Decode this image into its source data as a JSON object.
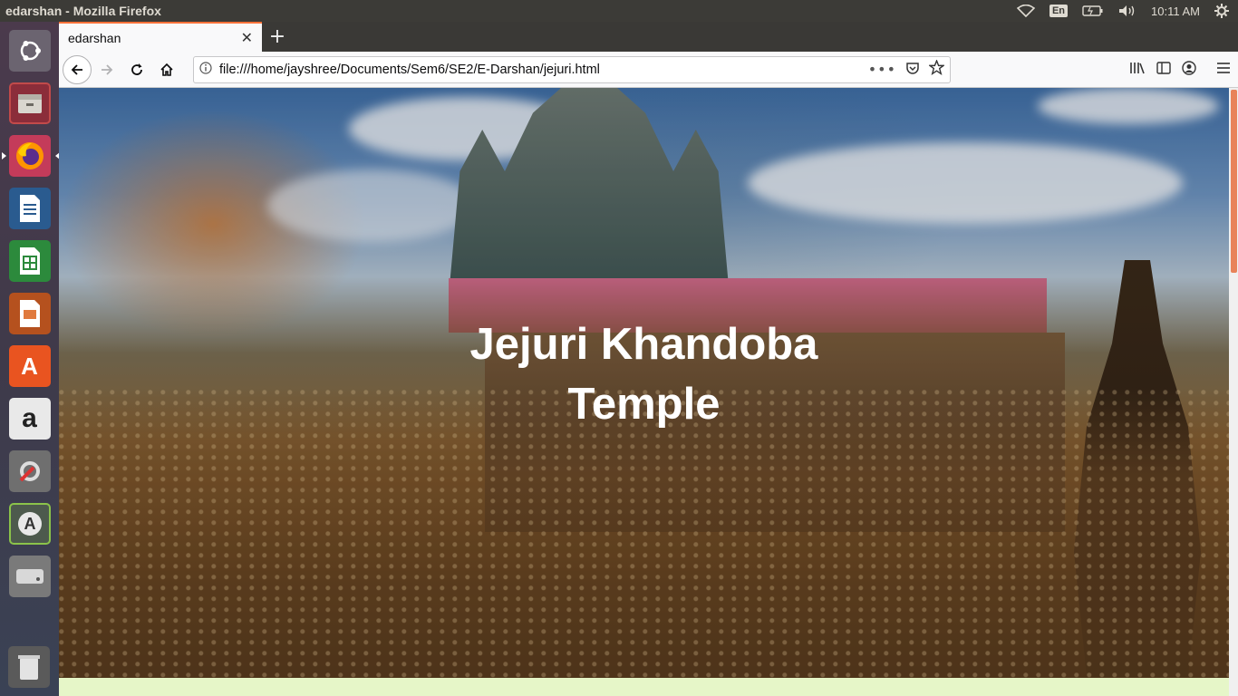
{
  "os_panel": {
    "window_title": "edarshan - Mozilla Firefox",
    "keyboard_layout": "En",
    "clock": "10:11 AM",
    "icons": [
      "wifi-icon",
      "keyboard-layout-indicator",
      "battery-icon",
      "volume-icon",
      "settings-gear-icon"
    ]
  },
  "launcher": {
    "items": [
      {
        "name": "ubuntu-dash-icon"
      },
      {
        "name": "files-icon"
      },
      {
        "name": "firefox-icon"
      },
      {
        "name": "libreoffice-writer-icon"
      },
      {
        "name": "libreoffice-calc-icon"
      },
      {
        "name": "libreoffice-impress-icon"
      },
      {
        "name": "ubuntu-software-icon"
      },
      {
        "name": "amazon-icon"
      },
      {
        "name": "system-settings-icon"
      },
      {
        "name": "software-updater-icon"
      },
      {
        "name": "disk-icon"
      },
      {
        "name": "trash-icon"
      }
    ]
  },
  "browser": {
    "tab_title": "edarshan",
    "url": "file:///home/jayshree/Documents/Sem6/SE2/E-Darshan/jejuri.html",
    "toolbar_icons": [
      "back-icon",
      "forward-icon",
      "reload-icon",
      "home-icon",
      "info-icon",
      "more-actions-icon",
      "pocket-icon",
      "bookmark-star-icon",
      "library-icon",
      "sidebar-icon",
      "account-icon",
      "menu-icon"
    ]
  },
  "page": {
    "hero": {
      "title_line1": "Jejuri Khandoba",
      "title_line2": "Temple"
    },
    "colors": {
      "accent_tab": "#ff7139",
      "scroll_thumb": "#e8835a",
      "footer_strip": "#e6f6c8"
    }
  }
}
